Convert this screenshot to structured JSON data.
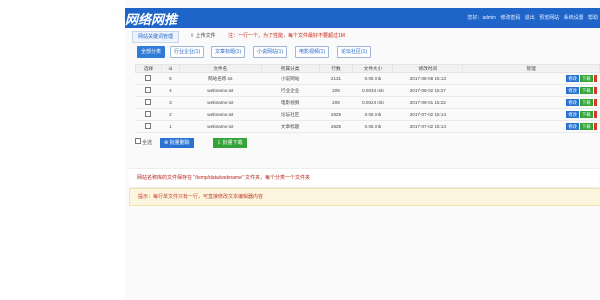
{
  "header": {
    "logo": "网络网推",
    "nav": [
      "您好：admin",
      "修改密码",
      "退出",
      "预览网站",
      "系统设置",
      "帮助"
    ]
  },
  "subnav": {
    "tab_active": "网站关键词管理",
    "upload": "上传文件",
    "notice": "注：一行一个，为了性能，每个文件最好不要超过1M"
  },
  "categories": [
    {
      "label": "全部分类",
      "active": true
    },
    {
      "label": "行业企业(1)",
      "active": false
    },
    {
      "label": "文章标题(1)",
      "active": false
    },
    {
      "label": "小说网站(1)",
      "active": false
    },
    {
      "label": "电影视频(1)",
      "active": false
    },
    {
      "label": "论坛社区(1)",
      "active": false
    }
  ],
  "table": {
    "headers": [
      "选择",
      "id",
      "文件名",
      "所属分类",
      "行数",
      "文件大小",
      "修改时间",
      "管理"
    ],
    "rows": [
      {
        "id": "5",
        "name": "网站名称.txt",
        "category": "小说网站",
        "lines": "2131",
        "size": "0.05 mb",
        "time": "2017-08-09 15:13"
      },
      {
        "id": "4",
        "name": "webname.txt",
        "category": "行业企业",
        "lines": "209",
        "size": "0.0034 mb",
        "time": "2017-08-02 15:27"
      },
      {
        "id": "3",
        "name": "webname.txt",
        "category": "电影视频",
        "lines": "209",
        "size": "0.0024 mb",
        "time": "2017-08-01 15:22"
      },
      {
        "id": "2",
        "name": "webname.txt",
        "category": "论坛社区",
        "lines": "2625",
        "size": "0.05 mb",
        "time": "2017-07-02 15:14"
      },
      {
        "id": "1",
        "name": "webname.txt",
        "category": "文章标题",
        "lines": "2625",
        "size": "0.05 mb",
        "time": "2017-07-02 15:14"
      }
    ],
    "actions": {
      "edit": "修改",
      "download": "下载"
    }
  },
  "bulk": {
    "select_all": "全选",
    "delete": "批量删除",
    "download": "批量下载"
  },
  "info_text": "网站名称库的文件保存在 \"/temp/data/webname\" 文件夹，每个分类一个文件夹",
  "tip_text": "提示：每行单文件只有一行，可直接修改文本编辑器内容",
  "colors": {
    "primary": "#1f64c8",
    "success": "#33a33a",
    "danger": "#d23a2a",
    "warning_bg": "#fdf6df"
  }
}
